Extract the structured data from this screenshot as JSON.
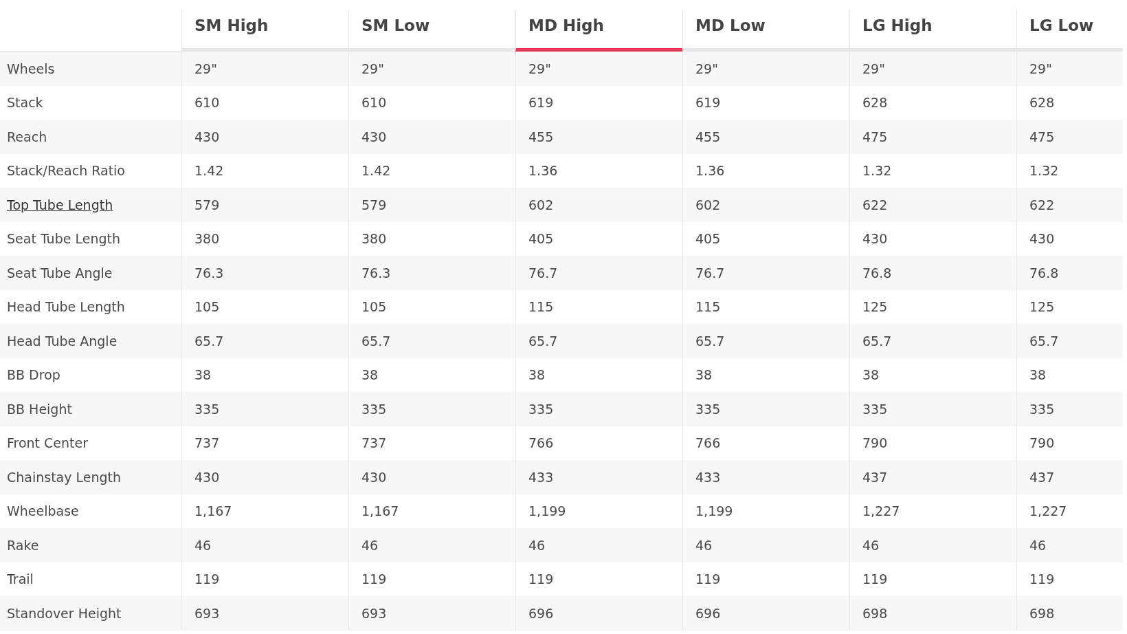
{
  "table": {
    "columns": [
      {
        "label": "SM High",
        "selected": false
      },
      {
        "label": "SM Low",
        "selected": false
      },
      {
        "label": "MD High",
        "selected": true
      },
      {
        "label": "MD Low",
        "selected": false
      },
      {
        "label": "LG High",
        "selected": false
      },
      {
        "label": "LG Low",
        "selected": false
      }
    ],
    "rows": [
      {
        "label": "Wheels",
        "kind": "text",
        "values": [
          "29\"",
          "29\"",
          "29\"",
          "29\"",
          "29\"",
          "29\""
        ]
      },
      {
        "label": "Stack",
        "kind": "text",
        "values": [
          "610",
          "610",
          "619",
          "619",
          "628",
          "628"
        ]
      },
      {
        "label": "Reach",
        "kind": "text",
        "values": [
          "430",
          "430",
          "455",
          "455",
          "475",
          "475"
        ]
      },
      {
        "label": "Stack/Reach Ratio",
        "kind": "text",
        "values": [
          "1.42",
          "1.42",
          "1.36",
          "1.36",
          "1.32",
          "1.32"
        ]
      },
      {
        "label": "Top Tube Length",
        "kind": "link",
        "values": [
          "579",
          "579",
          "602",
          "602",
          "622",
          "622"
        ]
      },
      {
        "label": "Seat Tube Length",
        "kind": "text",
        "values": [
          "380",
          "380",
          "405",
          "405",
          "430",
          "430"
        ]
      },
      {
        "label": "Seat Tube Angle",
        "kind": "text",
        "values": [
          "76.3",
          "76.3",
          "76.7",
          "76.7",
          "76.8",
          "76.8"
        ]
      },
      {
        "label": "Head Tube Length",
        "kind": "text",
        "values": [
          "105",
          "105",
          "115",
          "115",
          "125",
          "125"
        ]
      },
      {
        "label": "Head Tube Angle",
        "kind": "text",
        "values": [
          "65.7",
          "65.7",
          "65.7",
          "65.7",
          "65.7",
          "65.7"
        ]
      },
      {
        "label": "BB Drop",
        "kind": "text",
        "values": [
          "38",
          "38",
          "38",
          "38",
          "38",
          "38"
        ]
      },
      {
        "label": "BB Height",
        "kind": "text",
        "values": [
          "335",
          "335",
          "335",
          "335",
          "335",
          "335"
        ]
      },
      {
        "label": "Front Center",
        "kind": "text",
        "values": [
          "737",
          "737",
          "766",
          "766",
          "790",
          "790"
        ]
      },
      {
        "label": "Chainstay Length",
        "kind": "text",
        "values": [
          "430",
          "430",
          "433",
          "433",
          "437",
          "437"
        ]
      },
      {
        "label": "Wheelbase",
        "kind": "text",
        "values": [
          "1,167",
          "1,167",
          "1,199",
          "1,199",
          "1,227",
          "1,227"
        ]
      },
      {
        "label": "Rake",
        "kind": "text",
        "values": [
          "46",
          "46",
          "46",
          "46",
          "46",
          "46"
        ]
      },
      {
        "label": "Trail",
        "kind": "text",
        "values": [
          "119",
          "119",
          "119",
          "119",
          "119",
          "119"
        ]
      },
      {
        "label": "Standover Height",
        "kind": "text",
        "values": [
          "693",
          "693",
          "696",
          "696",
          "698",
          "698"
        ]
      }
    ]
  }
}
